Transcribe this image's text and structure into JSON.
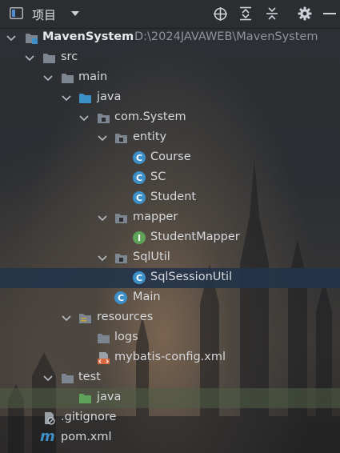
{
  "toolbar": {
    "title": "项目",
    "icons": [
      "tool-window-icon",
      "dropdown-icon",
      "locate-icon",
      "expand-all-icon",
      "collapse-all-icon",
      "gear-icon",
      "minimize-icon"
    ]
  },
  "tree": {
    "root": {
      "name": "MavenSystem",
      "path": "D:\\2024JAVAWEB\\MavenSystem"
    },
    "nodes": [
      {
        "label": "src"
      },
      {
        "label": "main"
      },
      {
        "label": "java"
      },
      {
        "label": "com.System"
      },
      {
        "label": "entity"
      },
      {
        "label": "Course"
      },
      {
        "label": "SC"
      },
      {
        "label": "Student"
      },
      {
        "label": "mapper"
      },
      {
        "label": "StudentMapper"
      },
      {
        "label": "SqlUtil"
      },
      {
        "label": "SqlSessionUtil"
      },
      {
        "label": "Main"
      },
      {
        "label": "resources"
      },
      {
        "label": "logs"
      },
      {
        "label": "mybatis-config.xml"
      },
      {
        "label": "test"
      },
      {
        "label": "java"
      },
      {
        "label": ".gitignore"
      },
      {
        "label": "pom.xml"
      }
    ],
    "badges": {
      "class": "C",
      "interface": "I",
      "maven": "m"
    }
  },
  "colors": {
    "folder": "#7d8590",
    "source_folder": "#3d8fc7",
    "test_folder": "#5fa35a",
    "class_badge": "#3d8fc7",
    "interface_badge": "#5fa35a",
    "selection": "#24344a"
  }
}
